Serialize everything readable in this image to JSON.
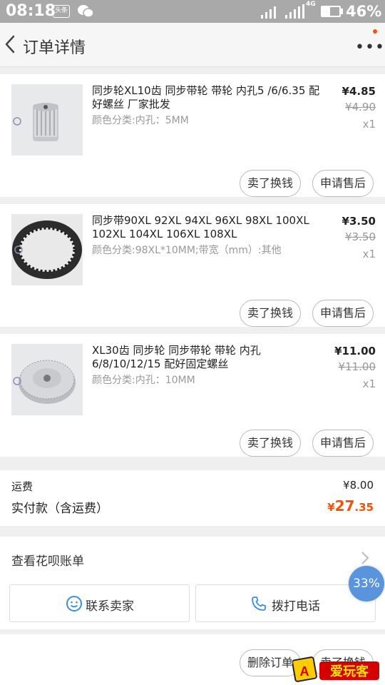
{
  "status_bar": {
    "time": "08:18",
    "badge": "头条",
    "network": "4G",
    "battery": "46%",
    "battery_level": 0.46
  },
  "header": {
    "title": "订单详情",
    "more": "•••"
  },
  "items": [
    {
      "name": "同步轮XL10齿 同步带轮 带轮 内孔5 /6/6.35 配好螺丝 厂家批发",
      "spec": "颜色分类:内孔：5MM",
      "price": "¥4.85",
      "original_price": "¥4.90",
      "qty": "x1",
      "btn_sell": "卖了换钱",
      "btn_service": "申请售后"
    },
    {
      "name": "同步带90XL 92XL 94XL 96XL 98XL 100XL 102XL 104XL 106XL 108XL",
      "spec": "颜色分类:98XL*10MM;带宽（mm）:其他",
      "price": "¥3.50",
      "original_price": "¥3.50",
      "qty": "x1",
      "btn_sell": "卖了换钱",
      "btn_service": "申请售后"
    },
    {
      "name": "XL30齿 同步轮 同步带轮 带轮 内孔6/8/10/12/15 配好固定螺丝",
      "spec": "颜色分类:内孔：10MM",
      "price": "¥11.00",
      "original_price": "¥11.00",
      "qty": "x1",
      "btn_sell": "卖了换钱",
      "btn_service": "申请售后"
    }
  ],
  "totals": {
    "shipping_label": "运费",
    "shipping_value": "¥8.00",
    "paid_label": "实付款（含运费）",
    "paid_currency": "¥",
    "paid_int": "27",
    "paid_dec": ".35"
  },
  "huabei": {
    "label": "查看花呗账单"
  },
  "actions": {
    "contact": "联系卖家",
    "call": "拨打电话"
  },
  "progress_badge": "33%",
  "bottom": {
    "delete": "删除订单",
    "sell": "卖了换钱"
  },
  "watermark": "爱玩客",
  "colors": {
    "accent": "#ff5000",
    "status_bar": "#a9a9a9",
    "icon_blue": "#3a8ee6",
    "badge_blue": "#5a94dc"
  }
}
